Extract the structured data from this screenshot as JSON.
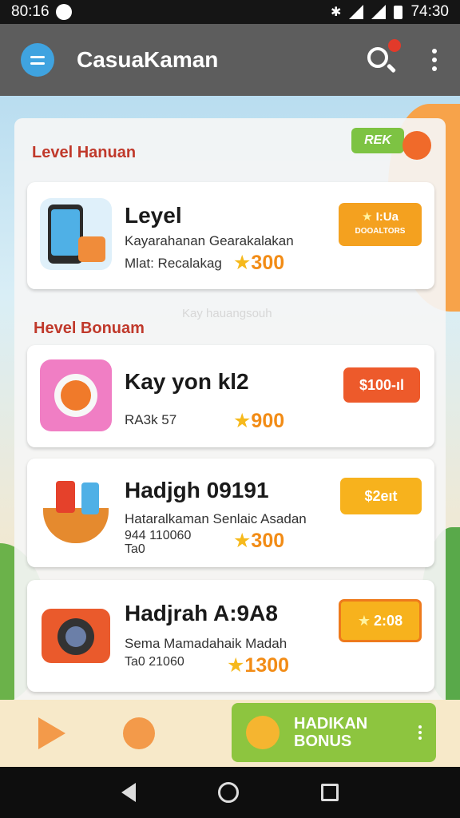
{
  "status_bar": {
    "time": "80:16",
    "clock": "74:30",
    "icons": [
      "notification-icon",
      "bluetooth-icon",
      "wifi-icon",
      "signal-icon",
      "signal-icon",
      "battery-icon"
    ]
  },
  "app_bar": {
    "title": "CasuaKaman",
    "menu_icon": "menu-icon",
    "search_icon": "search-icon",
    "more_icon": "more-vert-icon"
  },
  "top_section": {
    "heading": "Level Hanuan",
    "new_chip": "REK"
  },
  "second_section": {
    "heading": "Hevel Bonuam",
    "faint_text": "Kay hauangsouh"
  },
  "cards": [
    {
      "title": "Leyel",
      "desc": "Kayarahanan Gearakalakan",
      "sub": "Mlat: Recalakag",
      "coins": "300",
      "button_top": "I:Ua",
      "button_bottom": "DOOALTORS",
      "thumb_icon": "phone-icon",
      "button_color": "#f4a11f"
    },
    {
      "title": "Kay yon kl2",
      "desc": "",
      "sub": "RA3k 57",
      "coins": "900",
      "button_label": "$100-ıl",
      "thumb_icon": "camera-app-icon",
      "button_color": "#ed5a2b"
    },
    {
      "title": "Hadjgh 09191",
      "desc": "Hataralkaman Senlaic Asadan",
      "sub": "944 110060\nTa0",
      "coins": "300",
      "button_label": "$2eıt",
      "thumb_icon": "basket-icon",
      "button_color": "#f7b21d"
    },
    {
      "title": "Hadjrah A:9A8",
      "desc": "Sema Mamadahaik Madah",
      "sub": "Ta0 21060",
      "coins": "1300",
      "button_label": "2:08",
      "thumb_icon": "camera-icon",
      "button_color": "#f7b21d"
    }
  ],
  "bottom_bar": {
    "tab1_icon": "play-icon",
    "tab2_icon": "coin-icon",
    "bonus_label": "HADIKAN BONUS",
    "bonus_icon": "pig-icon"
  },
  "nav": [
    "back-icon",
    "home-icon",
    "recents-icon"
  ]
}
